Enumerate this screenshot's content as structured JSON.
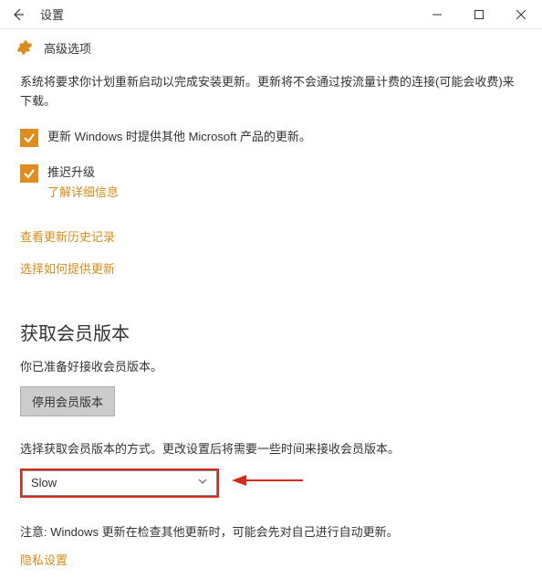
{
  "titlebar": {
    "title": "设置"
  },
  "subheader": {
    "title": "高级选项"
  },
  "intro_text": "系统将要求你计划重新启动以完成安装更新。更新将不会通过按流量计费的连接(可能会收费)来下载。",
  "checkbox1": {
    "label": "更新 Windows 时提供其他 Microsoft 产品的更新。"
  },
  "checkbox2": {
    "label": "推迟升级",
    "learn_more": "了解详细信息"
  },
  "links": {
    "history": "查看更新历史记录",
    "delivery": "选择如何提供更新"
  },
  "insider": {
    "heading": "获取会员版本",
    "ready_text": "你已准备好接收会员版本。",
    "stop_button": "停用会员版本",
    "method_text": "选择获取会员版本的方式。更改设置后将需要一些时间来接收会员版本。",
    "dropdown_value": "Slow",
    "note": "注意: Windows 更新在检查其他更新时，可能会先对自己进行自动更新。",
    "privacy_link": "隐私设置"
  }
}
